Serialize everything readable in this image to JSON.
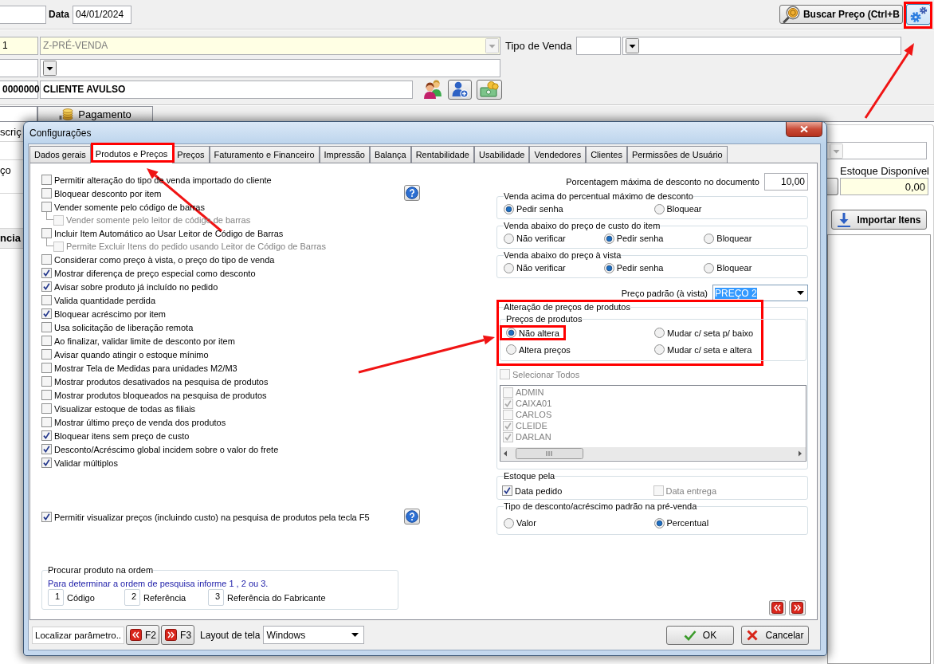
{
  "app": {
    "header": {
      "date_label": "Data",
      "date_value": "04/01/2024",
      "price_search_button": "Buscar Preço (Ctrl+B",
      "settings_button": {
        "highlighted": true
      }
    },
    "sale": {
      "code": "1",
      "name": "Z-PRÉ-VENDA",
      "name_disabled": true,
      "type_label": "Tipo de Venda"
    },
    "customer": {
      "code": "0000000",
      "name": "CLIENTE AVULSO"
    },
    "tabs": [
      {
        "icon": false,
        "selected": true
      },
      {
        "label": "Pagamento",
        "icon": true,
        "selected": false
      }
    ],
    "left_edge": {
      "column_header": "scriç",
      "label": "ço",
      "tab": "ncia"
    },
    "side_panel": {
      "filter_disabled": true,
      "stock_label": "Estoque Disponível",
      "stock_value": "0,00",
      "import_button": "Importar Itens"
    }
  },
  "dialog": {
    "title": "Configurações",
    "tabs": [
      {
        "label": "Dados gerais",
        "selected": false,
        "highlighted": false
      },
      {
        "label": "Produtos e Preços",
        "selected": true,
        "highlighted": true
      },
      {
        "label": "Preços",
        "selected": false,
        "highlighted": false
      },
      {
        "label": "Faturamento e Financeiro",
        "selected": false,
        "highlighted": false
      },
      {
        "label": "Impressão",
        "selected": false,
        "highlighted": false
      },
      {
        "label": "Balança",
        "selected": false,
        "highlighted": false
      },
      {
        "label": "Rentabilidade",
        "selected": false,
        "highlighted": false
      },
      {
        "label": "Usabilidade",
        "selected": false,
        "highlighted": false
      },
      {
        "label": "Vendedores",
        "selected": false,
        "highlighted": false
      },
      {
        "label": "Clientes",
        "selected": false,
        "highlighted": false
      },
      {
        "label": "Permissões de Usuário",
        "selected": false,
        "highlighted": false
      }
    ],
    "options": [
      {
        "label": "Permitir alteração do tipo de venda importado do cliente",
        "checked": false,
        "help": false
      },
      {
        "label": "Bloquear desconto por item",
        "checked": false,
        "help": true
      },
      {
        "label": "Vender somente pelo código de barras",
        "checked": false,
        "help": false,
        "children": [
          {
            "label": "Vender somente pelo leitor de código de barras",
            "checked": false,
            "disabled": true
          }
        ]
      },
      {
        "label": "Incluir Item Automático ao Usar Leitor de Código de Barras",
        "checked": false,
        "help": false,
        "children": [
          {
            "label": "Permite Excluir Itens do pedido usando Leitor de Código de Barras",
            "checked": false,
            "disabled": true
          }
        ]
      },
      {
        "label": "Considerar como preço à vista, o preço do tipo de venda",
        "checked": false,
        "help": false
      },
      {
        "label": "Mostrar diferença de preço especial como desconto",
        "checked": true,
        "help": false
      },
      {
        "label": "Avisar sobre produto já incluído no pedido",
        "checked": true,
        "help": false
      },
      {
        "label": "Valida quantidade perdida",
        "checked": false,
        "help": false
      },
      {
        "label": "Bloquear acréscimo por item",
        "checked": true,
        "help": false
      },
      {
        "label": "Usa solicitação de liberação remota",
        "checked": false,
        "help": false
      },
      {
        "label": "Ao finalizar, validar limite de desconto por item",
        "checked": false,
        "help": false
      },
      {
        "label": "Avisar quando atingir o estoque mínimo",
        "checked": false,
        "help": false
      },
      {
        "label": "Mostrar Tela de Medidas para unidades M2/M3",
        "checked": false,
        "help": false
      },
      {
        "label": "Mostrar produtos desativados na pesquisa de produtos",
        "checked": false,
        "help": false
      },
      {
        "label": "Mostrar produtos bloqueados na pesquisa de produtos",
        "checked": false,
        "help": false
      },
      {
        "label": "Visualizar estoque de todas as filiais",
        "checked": false,
        "help": false
      },
      {
        "label": "Mostrar último preço de venda dos produtos",
        "checked": false,
        "help": false
      },
      {
        "label": "Bloquear itens sem preço de custo",
        "checked": true,
        "help": false
      },
      {
        "label": "Desconto/Acréscimo global incidem sobre o valor do frete",
        "checked": true,
        "help": false
      },
      {
        "label": "Validar múltiplos",
        "checked": true,
        "help": false
      }
    ],
    "extra_options": [
      {
        "label": "Permitir visualizar preços (incluindo custo) na pesquisa de produtos pela tecla F5",
        "checked": true,
        "help": true
      }
    ],
    "search_order": {
      "title": "Procurar produto na ordem",
      "hint": "Para determinar a ordem de pesquisa informe 1 , 2 ou 3.",
      "fields": [
        {
          "value": "1",
          "label": "Código"
        },
        {
          "value": "2",
          "label": "Referência"
        },
        {
          "value": "3",
          "label": "Referência do Fabricante"
        }
      ]
    },
    "max_discount": {
      "label": "Porcentagem máxima de desconto no documento",
      "value": "10,00"
    },
    "radio_groups": [
      {
        "title": "Venda acima do percentual máximo de desconto",
        "options": [
          {
            "label": "Pedir senha",
            "selected": true
          },
          {
            "label": "Bloquear",
            "selected": false
          }
        ]
      },
      {
        "title": "Venda abaixo do preço de custo do item",
        "options": [
          {
            "label": "Não verificar",
            "selected": false
          },
          {
            "label": "Pedir senha",
            "selected": true
          },
          {
            "label": "Bloquear",
            "selected": false
          }
        ]
      },
      {
        "title": "Venda abaixo do preço à vista",
        "options": [
          {
            "label": "Não verificar",
            "selected": false
          },
          {
            "label": "Pedir senha",
            "selected": true
          },
          {
            "label": "Bloquear",
            "selected": false
          }
        ]
      }
    ],
    "default_price": {
      "label": "Preço padrão (à vista)",
      "value": "PREÇO 2",
      "value_selected": true
    },
    "price_change": {
      "title": "Alteração de preços de produtos",
      "highlighted": true,
      "subgroup": {
        "title": "Preços de produtos",
        "options": [
          {
            "label": "Não altera",
            "selected": true,
            "highlighted": true
          },
          {
            "label": "Mudar c/ seta p/ baixo",
            "selected": false,
            "highlighted": false
          },
          {
            "label": "Altera preços",
            "selected": false,
            "highlighted": false
          },
          {
            "label": "Mudar c/ seta e altera",
            "selected": false,
            "highlighted": false
          }
        ]
      },
      "select_all": {
        "label": "Selecionar Todos",
        "checked": false,
        "disabled": true
      },
      "users": [
        {
          "name": "ADMIN",
          "checked": false,
          "disabled": true
        },
        {
          "name": "CAIXA01",
          "checked": true,
          "disabled": true
        },
        {
          "name": "CARLOS",
          "checked": false,
          "disabled": true
        },
        {
          "name": "CLEIDE",
          "checked": true,
          "disabled": true
        },
        {
          "name": "DARLAN",
          "checked": true,
          "disabled": true
        }
      ]
    },
    "stock_by": {
      "title": "Estoque pela",
      "options": [
        {
          "label": "Data pedido",
          "checked": true,
          "disabled": false
        },
        {
          "label": "Data entrega",
          "checked": false,
          "disabled": true
        }
      ]
    },
    "discount_type": {
      "title": "Tipo de desconto/acréscimo padrão na pré-venda",
      "options": [
        {
          "label": "Valor",
          "selected": false
        },
        {
          "label": "Percentual",
          "selected": true
        }
      ]
    },
    "footer": {
      "search_value": "Localizar parâmetro..",
      "prev_key": "F2",
      "next_key": "F3",
      "layout_label": "Layout de tela",
      "layout_value": "Windows",
      "ok": "OK",
      "cancel": "Cancelar"
    }
  }
}
